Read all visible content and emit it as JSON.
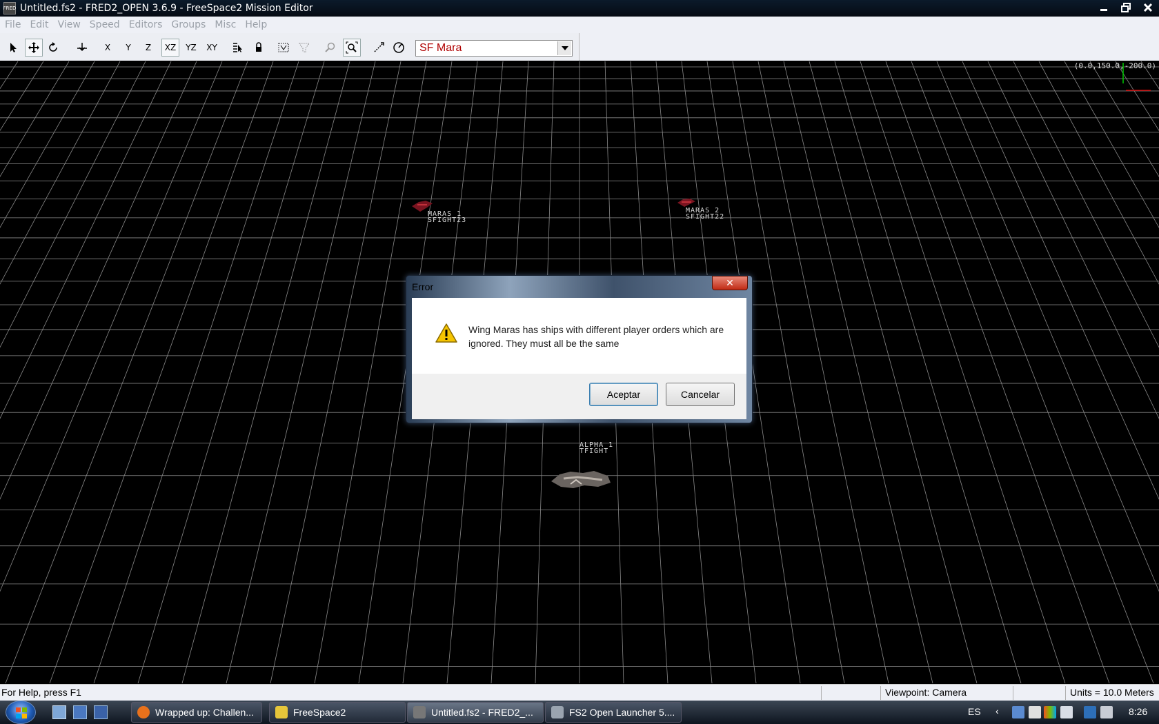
{
  "window": {
    "title": "Untitled.fs2 - FRED2_OPEN 3.6.9 - FreeSpace2 Mission Editor",
    "app_icon_text": "FRED"
  },
  "menu": [
    "File",
    "Edit",
    "View",
    "Speed",
    "Editors",
    "Groups",
    "Misc",
    "Help"
  ],
  "toolbar": {
    "axis_buttons": [
      "X",
      "Y",
      "Z",
      "XZ",
      "YZ",
      "XY"
    ],
    "pressed_axis": "XZ",
    "ship_select_value": "SF Mara"
  },
  "viewport": {
    "coords": "(0.0,150.0,-200.0)",
    "ships": [
      {
        "name": "MARAS 1",
        "class": "SFIGHT23"
      },
      {
        "name": "MARAS 2",
        "class": "SFIGHT22"
      },
      {
        "name": "ALPHA 1",
        "class": "TFIGHT"
      }
    ]
  },
  "dialog": {
    "title": "Error",
    "close_glyph": "✕",
    "message": "Wing Maras has ships with different player orders which are ignored.  They must all be the same",
    "ok_label": "Aceptar",
    "cancel_label": "Cancelar"
  },
  "status": {
    "help": "For Help, press F1",
    "viewpoint": "Viewpoint: Camera",
    "units": "Units = 10.0 Meters"
  },
  "taskbar": {
    "tasks": [
      {
        "label": "Wrapped up: Challen...",
        "icon_color": "#e8711c"
      },
      {
        "label": "FreeSpace2",
        "icon_color": "#e6c63a"
      },
      {
        "label": "Untitled.fs2 - FRED2_...",
        "icon_color": "#777777"
      },
      {
        "label": "FS2 Open Launcher 5....",
        "icon_color": "#9aa4b0"
      }
    ],
    "language": "ES",
    "clock": "8:26"
  }
}
